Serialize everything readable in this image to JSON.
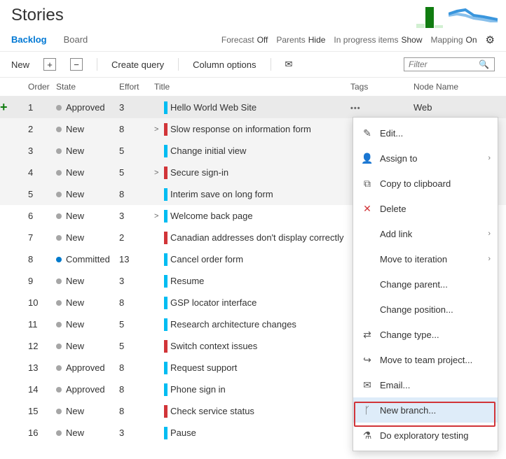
{
  "header": {
    "title": "Stories"
  },
  "tabs": {
    "backlog": "Backlog",
    "board": "Board"
  },
  "toggles": {
    "forecast_label": "Forecast",
    "forecast_value": "Off",
    "parents_label": "Parents",
    "parents_value": "Hide",
    "progress_label": "In progress items",
    "progress_value": "Show",
    "mapping_label": "Mapping",
    "mapping_value": "On"
  },
  "toolbar": {
    "new": "New",
    "create_query": "Create query",
    "column_options": "Column options"
  },
  "search": {
    "placeholder": "Filter"
  },
  "columns": {
    "order": "Order",
    "state": "State",
    "effort": "Effort",
    "title": "Title",
    "tags": "Tags",
    "node": "Node Name"
  },
  "rows": [
    {
      "order": "1",
      "state": "Approved",
      "dot": "gray",
      "effort": "3",
      "pill": "teal",
      "chev": "",
      "title": "Hello World Web Site",
      "node": "Web"
    },
    {
      "order": "2",
      "state": "New",
      "dot": "gray",
      "effort": "8",
      "pill": "red",
      "chev": ">",
      "title": "Slow response on information form",
      "node": ""
    },
    {
      "order": "3",
      "state": "New",
      "dot": "gray",
      "effort": "5",
      "pill": "teal",
      "chev": "",
      "title": "Change initial view",
      "node": ""
    },
    {
      "order": "4",
      "state": "New",
      "dot": "gray",
      "effort": "5",
      "pill": "red",
      "chev": ">",
      "title": "Secure sign-in",
      "node": ""
    },
    {
      "order": "5",
      "state": "New",
      "dot": "gray",
      "effort": "8",
      "pill": "teal",
      "chev": "",
      "title": "Interim save on long form",
      "node": ""
    },
    {
      "order": "6",
      "state": "New",
      "dot": "gray",
      "effort": "3",
      "pill": "teal",
      "chev": ">",
      "title": "Welcome back page",
      "node": ""
    },
    {
      "order": "7",
      "state": "New",
      "dot": "gray",
      "effort": "2",
      "pill": "red",
      "chev": "",
      "title": "Canadian addresses don't display correctly",
      "node": ""
    },
    {
      "order": "8",
      "state": "Committed",
      "dot": "blue",
      "effort": "13",
      "pill": "teal",
      "chev": "",
      "title": "Cancel order form",
      "node": ""
    },
    {
      "order": "9",
      "state": "New",
      "dot": "gray",
      "effort": "3",
      "pill": "teal",
      "chev": "",
      "title": "Resume",
      "node": ""
    },
    {
      "order": "10",
      "state": "New",
      "dot": "gray",
      "effort": "8",
      "pill": "teal",
      "chev": "",
      "title": "GSP locator interface",
      "node": ""
    },
    {
      "order": "11",
      "state": "New",
      "dot": "gray",
      "effort": "5",
      "pill": "teal",
      "chev": "",
      "title": "Research architecture changes",
      "node": ""
    },
    {
      "order": "12",
      "state": "New",
      "dot": "gray",
      "effort": "5",
      "pill": "red",
      "chev": "",
      "title": "Switch context issues",
      "node": ""
    },
    {
      "order": "13",
      "state": "Approved",
      "dot": "gray",
      "effort": "8",
      "pill": "teal",
      "chev": "",
      "title": "Request support",
      "node": ""
    },
    {
      "order": "14",
      "state": "Approved",
      "dot": "gray",
      "effort": "8",
      "pill": "teal",
      "chev": "",
      "title": "Phone sign in",
      "node": ""
    },
    {
      "order": "15",
      "state": "New",
      "dot": "gray",
      "effort": "8",
      "pill": "red",
      "chev": "",
      "title": "Check service status",
      "node": ""
    },
    {
      "order": "16",
      "state": "New",
      "dot": "gray",
      "effort": "3",
      "pill": "teal",
      "chev": "",
      "title": "Pause",
      "node": ""
    }
  ],
  "menu": {
    "edit": "Edit...",
    "assign_to": "Assign to",
    "copy_clipboard": "Copy to clipboard",
    "delete": "Delete",
    "add_link": "Add link",
    "move_iteration": "Move to iteration",
    "change_parent": "Change parent...",
    "change_position": "Change position...",
    "change_type": "Change type...",
    "move_team_project": "Move to team project...",
    "email": "Email...",
    "new_branch": "New branch...",
    "exploratory": "Do exploratory testing"
  }
}
